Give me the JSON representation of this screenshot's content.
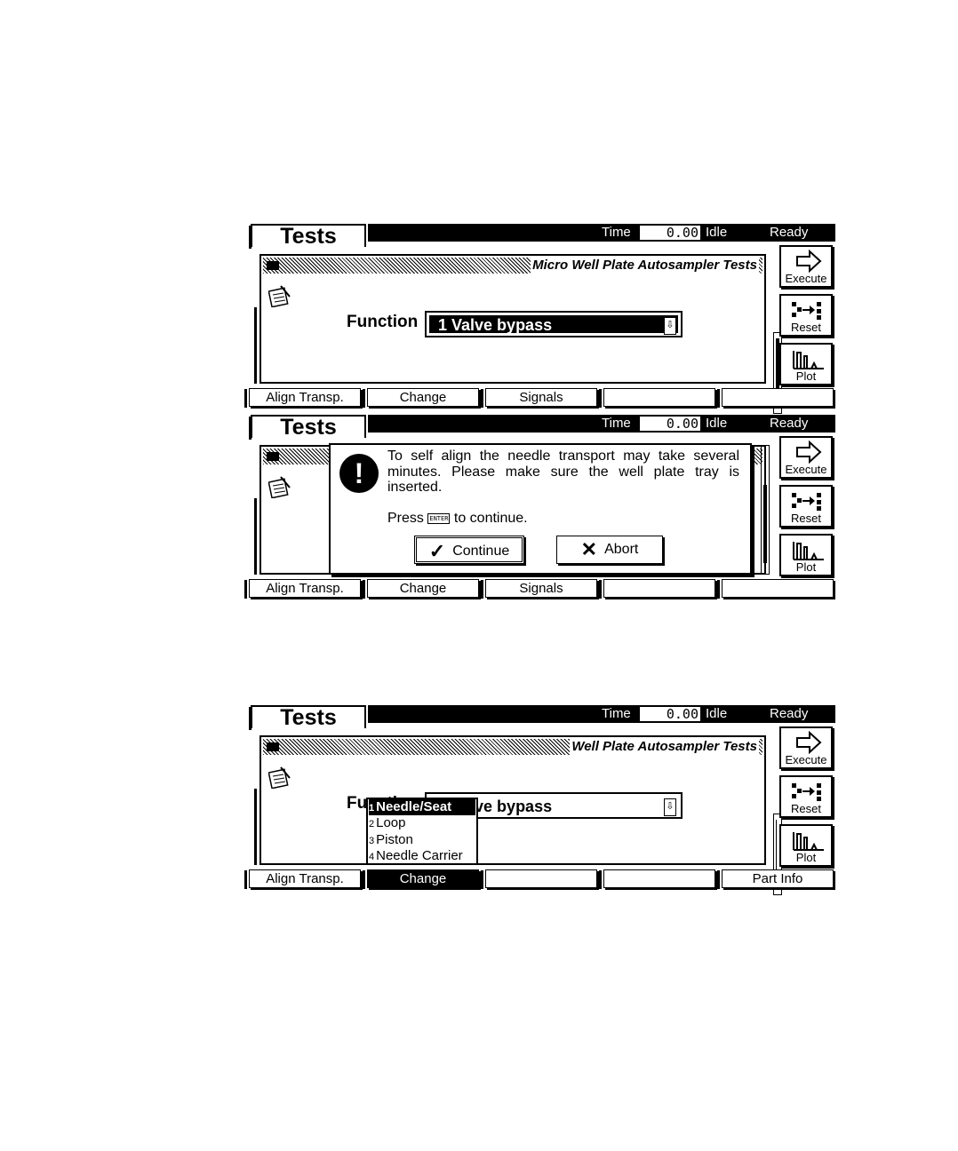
{
  "screens": [
    {
      "title": "Tests",
      "status": {
        "time_label": "Time",
        "time_value": "0.00",
        "state": "Idle",
        "ready": "Ready"
      },
      "panel_title": "Micro Well Plate Autosampler Tests",
      "function_label": "Function",
      "function_value": "1 Valve bypass",
      "side_buttons": [
        "Execute",
        "Reset",
        "Plot"
      ],
      "softkeys": [
        "Align Transp.",
        "Change",
        "Signals",
        "",
        ""
      ]
    },
    {
      "title": "Tests",
      "status": {
        "time_label": "Time",
        "time_value": "0.00",
        "state": "Idle",
        "ready": "Ready"
      },
      "dialog": {
        "message": "To self align the needle transport may take several minutes. Please make sure the well plate tray is inserted.",
        "press_before": "Press",
        "enter_key": "ENTER",
        "press_after": "to continue.",
        "continue_label": "Continue",
        "abort_label": "Abort"
      },
      "side_buttons": [
        "Execute",
        "Reset",
        "Plot"
      ],
      "softkeys": [
        "Align Transp.",
        "Change",
        "Signals",
        "",
        ""
      ]
    },
    {
      "title": "Tests",
      "status": {
        "time_label": "Time",
        "time_value": "0.00",
        "state": "Idle",
        "ready": "Ready"
      },
      "panel_title": "Well Plate Autosampler Tests",
      "function_label": "Function",
      "function_value": "1 Valve bypass",
      "dropdown": [
        {
          "num": "1",
          "label": "Needle/Seat"
        },
        {
          "num": "2",
          "label": "Loop"
        },
        {
          "num": "3",
          "label": "Piston"
        },
        {
          "num": "4",
          "label": "Needle Carrier"
        }
      ],
      "side_buttons": [
        "Execute",
        "Reset",
        "Plot"
      ],
      "softkeys": [
        "Align Transp.",
        "Change",
        "",
        "",
        "Part Info"
      ]
    }
  ]
}
